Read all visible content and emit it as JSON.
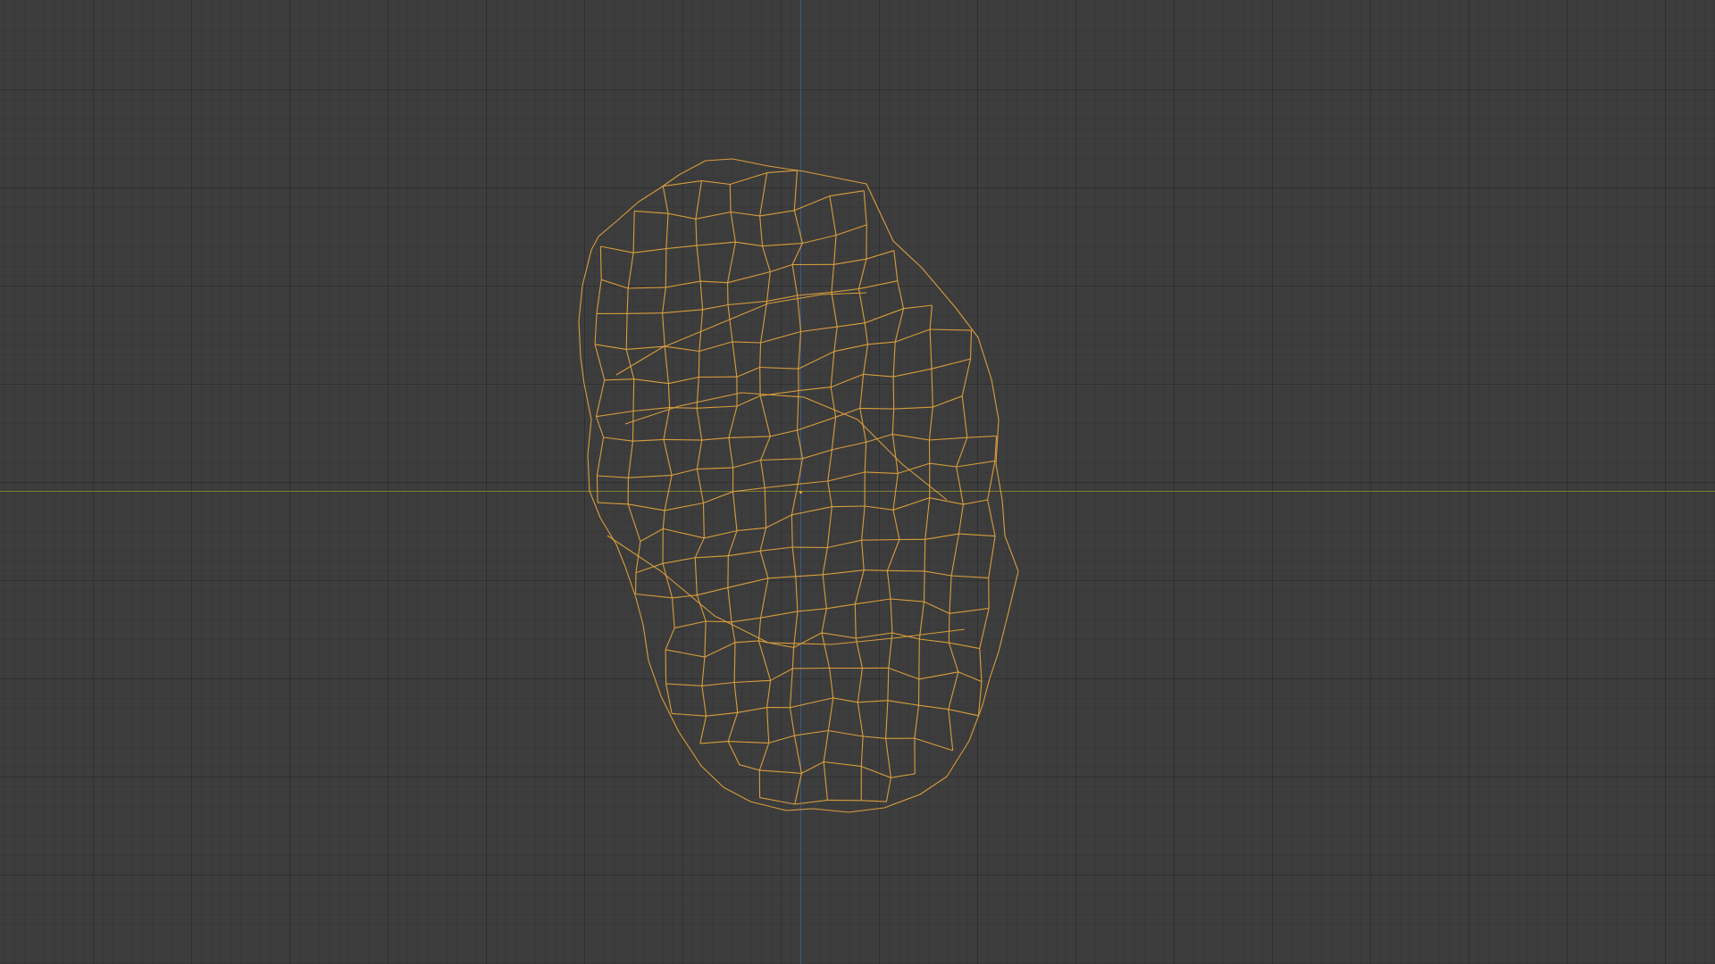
{
  "viewport": {
    "mode": "wireframe",
    "object": "rock-mesh",
    "colors": {
      "background": "#3d3d3d",
      "wire": "#e0a23c",
      "x_axis": "#8a8a36",
      "y_axis": "#3f5a8a"
    }
  }
}
